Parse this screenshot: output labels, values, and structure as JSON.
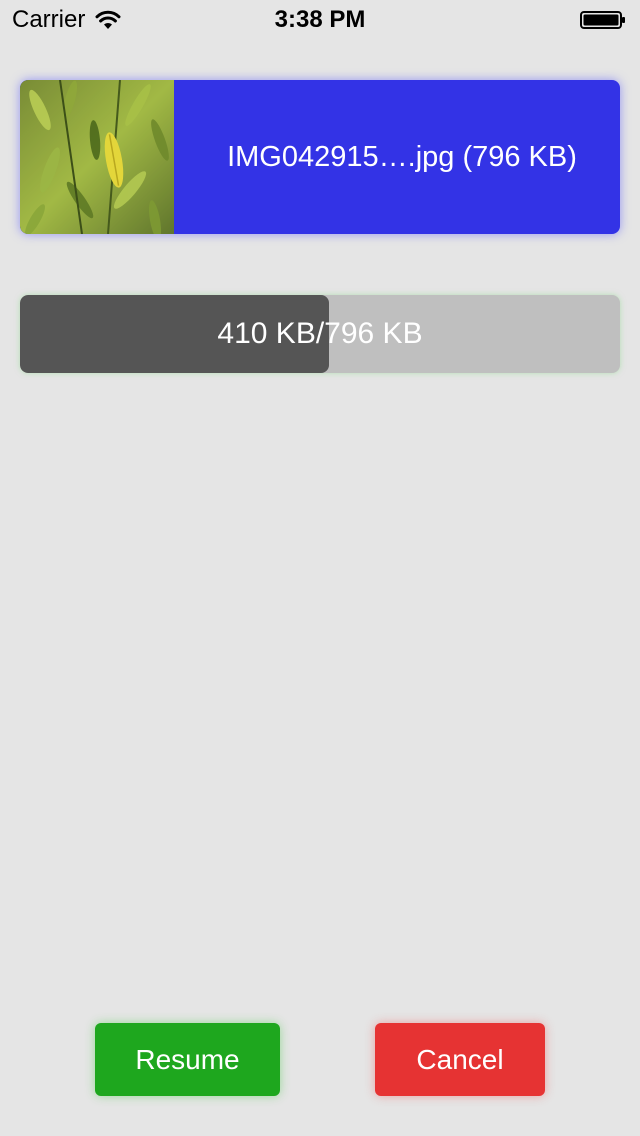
{
  "status_bar": {
    "carrier": "Carrier",
    "time": "3:38 PM",
    "wifi_icon": "wifi-icon",
    "battery_icon": "battery-icon"
  },
  "file": {
    "name": "IMG042915….jpg (796 KB)",
    "thumbnail": "leaf-photo-thumbnail",
    "card_color": "#3333e6"
  },
  "progress": {
    "label": "410 KB/796 KB",
    "loaded_kb": 410,
    "total_kb": 796,
    "fill_color": "#555555",
    "track_color": "#bfbfbf"
  },
  "actions": {
    "resume_label": "Resume",
    "resume_color": "#1ea71e",
    "cancel_label": "Cancel",
    "cancel_color": "#e63333"
  }
}
